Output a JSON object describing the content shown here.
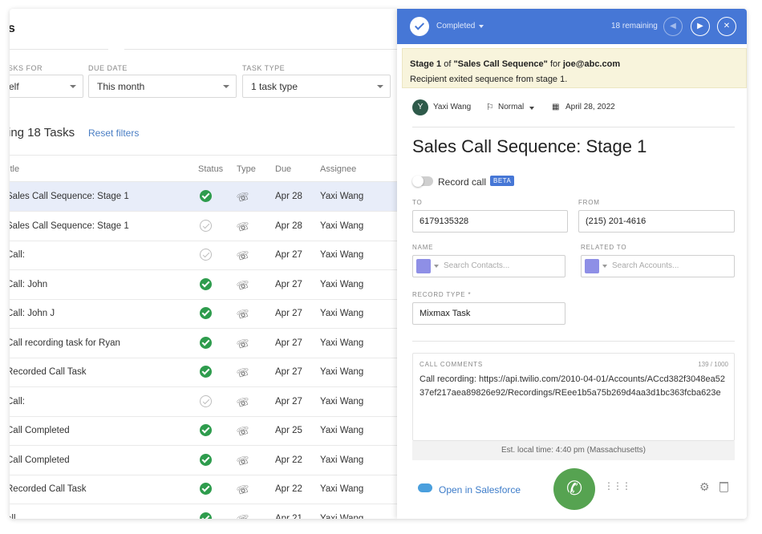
{
  "left": {
    "page_title": "s",
    "filters": [
      {
        "label": "SKS FOR",
        "value": "elf"
      },
      {
        "label": "DUE DATE",
        "value": "This month"
      },
      {
        "label": "TASK TYPE",
        "value": "1 task type"
      }
    ],
    "showing": "ing 18 Tasks",
    "reset_filters": "Reset filters",
    "columns": {
      "title": "itle",
      "status": "Status",
      "type": "Type",
      "due": "Due",
      "assignee": "Assignee"
    },
    "rows": [
      {
        "title": "Sales Call Sequence: Stage 1",
        "status": "done",
        "due": "Apr 28",
        "assignee": "Yaxi Wang"
      },
      {
        "title": "Sales Call Sequence: Stage 1",
        "status": "open",
        "due": "Apr 28",
        "assignee": "Yaxi Wang"
      },
      {
        "title": "Call:",
        "status": "open",
        "due": "Apr 27",
        "assignee": "Yaxi Wang"
      },
      {
        "title": "Call: John",
        "status": "done",
        "due": "Apr 27",
        "assignee": "Yaxi Wang"
      },
      {
        "title": "Call: John J",
        "status": "done",
        "due": "Apr 27",
        "assignee": "Yaxi Wang"
      },
      {
        "title": "Call recording task for Ryan",
        "status": "done",
        "due": "Apr 27",
        "assignee": "Yaxi Wang"
      },
      {
        "title": "Recorded Call Task",
        "status": "done",
        "due": "Apr 27",
        "assignee": "Yaxi Wang"
      },
      {
        "title": "Call:",
        "status": "open",
        "due": "Apr 27",
        "assignee": "Yaxi Wang"
      },
      {
        "title": "Call Completed",
        "status": "done",
        "due": "Apr 25",
        "assignee": "Yaxi Wang"
      },
      {
        "title": "Call Completed",
        "status": "done",
        "due": "Apr 22",
        "assignee": "Yaxi Wang"
      },
      {
        "title": "Recorded Call Task",
        "status": "done",
        "due": "Apr 22",
        "assignee": "Yaxi Wang"
      },
      {
        "title": "all",
        "status": "done",
        "due": "Apr 21",
        "assignee": "Yaxi Wang"
      }
    ]
  },
  "panel": {
    "status": "Completed",
    "remaining": "18 remaining",
    "notice": {
      "stage": "Stage 1",
      "of": "of",
      "sequence": "\"Sales Call Sequence\"",
      "for": "for",
      "email": "joe@abc.com",
      "line2": "Recipient exited sequence from stage 1."
    },
    "assignee_initial": "Y",
    "assignee": "Yaxi Wang",
    "priority": "Normal",
    "date": "April 28, 2022",
    "title": "Sales Call Sequence: Stage 1",
    "record_call": "Record call",
    "beta": "BETA",
    "to_label": "TO",
    "to_value": "6179135328",
    "from_label": "FROM",
    "from_value": "(215) 201-4616",
    "name_label": "NAME",
    "name_placeholder": "Search Contacts...",
    "related_label": "RELATED TO",
    "related_placeholder": "Search Accounts...",
    "record_type_label": "RECORD TYPE *",
    "record_type_value": "Mixmax Task",
    "comments_label": "CALL COMMENTS",
    "comments_count": "139 / 1000",
    "comments_text": "Call recording: https://api.twilio.com/2010-04-01/Accounts/ACcd382f3048ea5237ef217aea89826e92/Recordings/REee1b5a75b269d4aa3d1bc363fcba623e",
    "local_time": "Est. local time: 4:40 pm (Massachusetts)",
    "open_salesforce": "Open in Salesforce"
  },
  "icons": {
    "phone": "☏",
    "call": "✆",
    "gear": "⚙",
    "dialpad": "⋮⋮⋮",
    "prev": "◀",
    "next": "▶",
    "close": "✕",
    "flag": "⚐",
    "calendar": "▦"
  },
  "colors": {
    "accent": "#4677d6",
    "success": "#2e9c4d",
    "call": "#56a351",
    "notice_bg": "#f8f4dc"
  }
}
